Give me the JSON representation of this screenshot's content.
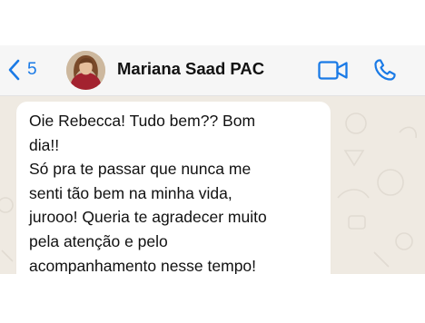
{
  "header": {
    "back_count": "5",
    "contact_name": "Mariana Saad PAC"
  },
  "colors": {
    "accent": "#1a7ae6",
    "chat_background": "#efeae2",
    "bubble": "#ffffff"
  },
  "icons": {
    "back": "chevron-left-icon",
    "video": "video-camera-icon",
    "call": "phone-icon"
  },
  "message": {
    "lines": [
      "Oie Rebecca! Tudo bem?? Bom",
      "dia!!",
      "Só pra te passar que nunca me",
      "senti tão bem na minha vida,",
      "jurooo! Queria te agradecer muito",
      "pela atenção e pelo",
      "acompanhamento nesse tempo!"
    ]
  }
}
